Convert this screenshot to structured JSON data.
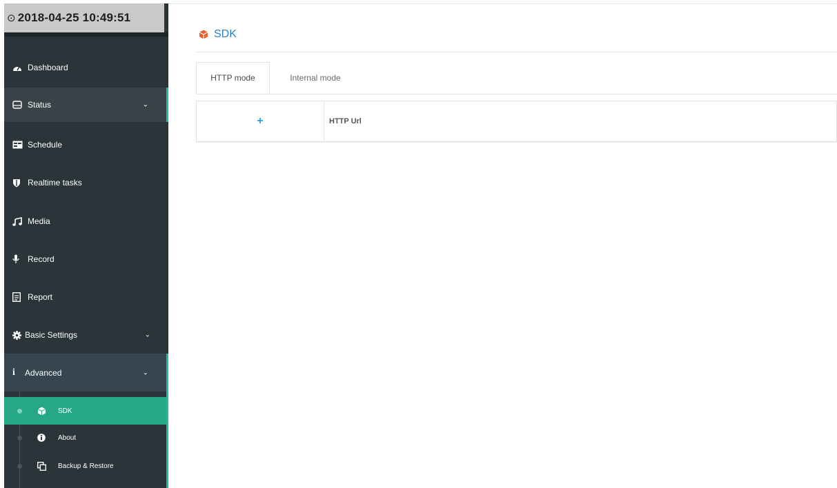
{
  "sidebar": {
    "datetime": "2018-04-25 10:49:51",
    "items": [
      {
        "label": "Dashboard",
        "icon": "dashboard-icon"
      },
      {
        "label": "Status",
        "icon": "status-icon",
        "expandable": true
      },
      {
        "label": "Schedule",
        "icon": "schedule-icon"
      },
      {
        "label": "Realtime tasks",
        "icon": "shield-icon"
      },
      {
        "label": "Media",
        "icon": "music-icon"
      },
      {
        "label": "Record",
        "icon": "microphone-icon"
      },
      {
        "label": "Report",
        "icon": "report-icon"
      },
      {
        "label": "Basic Settings",
        "icon": "gear-icon",
        "expandable": true
      },
      {
        "label": "Advanced",
        "icon": "info-icon",
        "expandable": true
      }
    ],
    "advanced_sub": [
      {
        "label": "SDK",
        "icon": "cube-icon",
        "active": true
      },
      {
        "label": "About",
        "icon": "info-circle-icon"
      },
      {
        "label": "Backup & Restore",
        "icon": "copy-icon"
      }
    ]
  },
  "main": {
    "title": "SDK",
    "tabs": [
      {
        "label": "HTTP mode",
        "active": true
      },
      {
        "label": "Internal mode",
        "active": false
      }
    ],
    "table": {
      "add_symbol": "+",
      "column_header": "HTTP Url"
    }
  },
  "colors": {
    "accent": "#26b99a",
    "sidebar_bg": "#2b3438",
    "title_blue": "#2e7fc2",
    "add_blue": "#23a4d8"
  }
}
